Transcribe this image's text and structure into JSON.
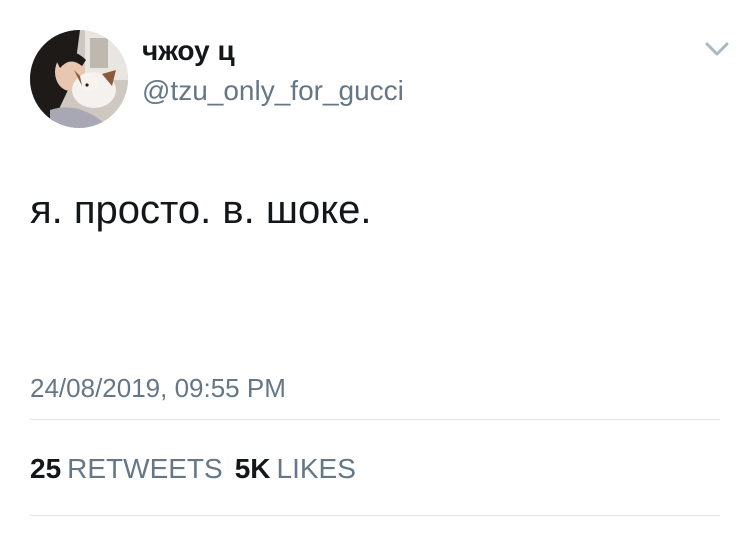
{
  "user": {
    "display_name": "чжоу ц",
    "handle": "@tzu_only_for_gucci",
    "avatar_icon": "profile-photo"
  },
  "menu": {
    "icon": "chevron-down-icon"
  },
  "tweet": {
    "text": "я. просто. в. шоке.",
    "timestamp": "24/08/2019, 09:55 PM"
  },
  "stats": {
    "retweets_count": "25",
    "retweets_label": "RETWEETS",
    "likes_count": "5K",
    "likes_label": "LIKES"
  },
  "colors": {
    "text_primary": "#14171a",
    "text_secondary": "#657786",
    "divider": "#e1e8ed",
    "background": "#ffffff"
  }
}
